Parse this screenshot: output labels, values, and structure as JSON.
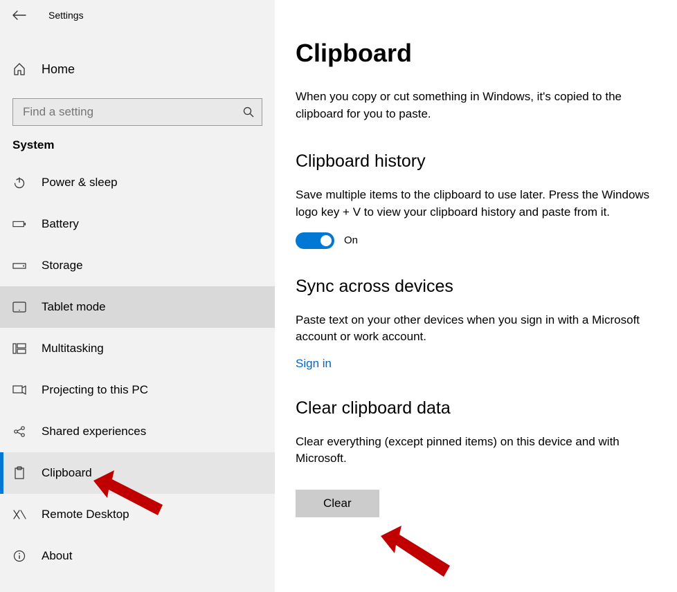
{
  "header": {
    "title": "Settings"
  },
  "home_label": "Home",
  "search": {
    "placeholder": "Find a setting"
  },
  "category_label": "System",
  "nav": {
    "items": [
      {
        "label": "Power & sleep"
      },
      {
        "label": "Battery"
      },
      {
        "label": "Storage"
      },
      {
        "label": "Tablet mode"
      },
      {
        "label": "Multitasking"
      },
      {
        "label": "Projecting to this PC"
      },
      {
        "label": "Shared experiences"
      },
      {
        "label": "Clipboard"
      },
      {
        "label": "Remote Desktop"
      },
      {
        "label": "About"
      }
    ]
  },
  "main": {
    "page_title": "Clipboard",
    "intro": "When you copy or cut something in Windows, it's copied to the clipboard for you to paste.",
    "history": {
      "heading": "Clipboard history",
      "desc": "Save multiple items to the clipboard to use later. Press the Windows logo key + V to view your clipboard history and paste from it.",
      "toggle_state": "On"
    },
    "sync": {
      "heading": "Sync across devices",
      "desc": "Paste text on your other devices when you sign in with a Microsoft account or work account.",
      "signin_label": "Sign in"
    },
    "clear": {
      "heading": "Clear clipboard data",
      "desc": "Clear everything (except pinned items) on this device and with Microsoft.",
      "button_label": "Clear"
    }
  }
}
